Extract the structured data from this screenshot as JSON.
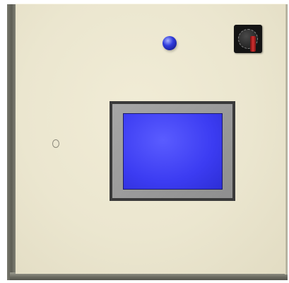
{
  "panel": {
    "indicator_light": {
      "icon": "indicator-light-icon",
      "color": "#2f3bdc"
    },
    "selector_switch": {
      "icon": "selector-switch-icon",
      "knob_color": "#d23030"
    },
    "lock": {
      "icon": "keyhole-icon"
    },
    "display": {
      "screen_color": "#3c3cf2",
      "frame_color": "#9a9a9a"
    },
    "door_color": "#ebe6cf"
  }
}
